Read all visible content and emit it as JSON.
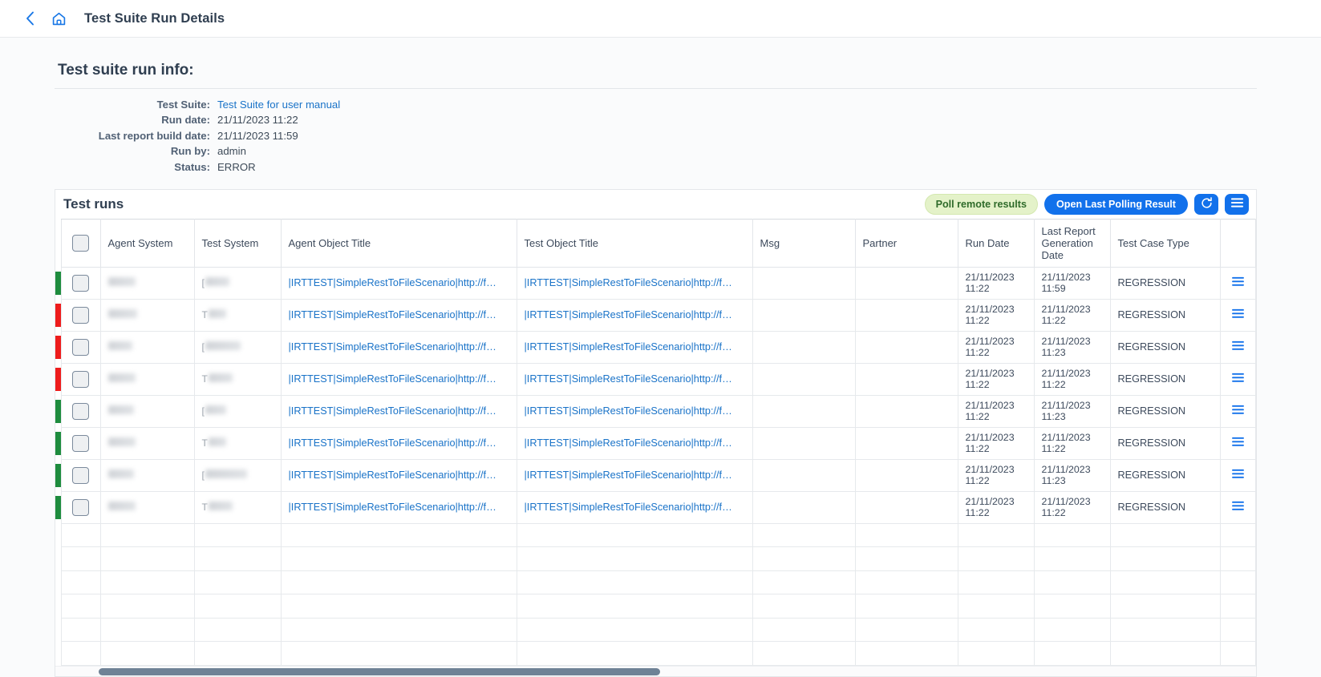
{
  "header": {
    "back_icon": "chevron-left-icon",
    "home_icon": "home-icon",
    "title": "Test Suite Run Details"
  },
  "info": {
    "section_title": "Test suite run info:",
    "rows": [
      {
        "label": "Test Suite:",
        "value": "Test Suite for user manual",
        "is_link": true
      },
      {
        "label": "Run date:",
        "value": "21/11/2023 11:22",
        "is_link": false
      },
      {
        "label": "Last report build date:",
        "value": "21/11/2023 11:59",
        "is_link": false
      },
      {
        "label": "Run by:",
        "value": "admin",
        "is_link": false
      },
      {
        "label": "Status:",
        "value": "ERROR",
        "is_link": false
      }
    ]
  },
  "test_runs": {
    "title": "Test runs",
    "toolbar": {
      "poll_label": "Poll remote results",
      "open_label": "Open Last Polling Result",
      "refresh_icon": "refresh-icon",
      "menu_icon": "hamburger-menu-icon"
    },
    "columns": [
      "",
      "",
      "Agent System",
      "Test System",
      "Agent Object Title",
      "Test Object Title",
      "Msg",
      "Partner",
      "Run Date",
      "Last Report Generation Date",
      "Test Case Type",
      ""
    ],
    "column_headers": {
      "agent_system": "Agent System",
      "test_system": "Test System",
      "agent_object_title": "Agent Object Title",
      "test_object_title": "Test Object Title",
      "msg": "Msg",
      "partner": "Partner",
      "run_date": "Run Date",
      "last_report_generation_date": "Last Report Generation Date",
      "test_case_type": "Test Case Type"
    },
    "object_title_text": "|IRTTEST|SimpleRestToFileScenario|http://f…",
    "rows": [
      {
        "status_color": "#1e8c3e",
        "agent_object_title": "|IRTTEST|SimpleRestToFileScenario|http://f…",
        "test_object_title": "|IRTTEST|SimpleRestToFileScenario|http://f…",
        "msg": "",
        "partner": "",
        "run_date": "21/11/2023 11:22",
        "gen_date": "21/11/2023 11:59",
        "test_case_type": "REGRESSION"
      },
      {
        "status_color": "#ee1c1c",
        "agent_object_title": "|IRTTEST|SimpleRestToFileScenario|http://f…",
        "test_object_title": "|IRTTEST|SimpleRestToFileScenario|http://f…",
        "msg": "",
        "partner": "",
        "run_date": "21/11/2023 11:22",
        "gen_date": "21/11/2023 11:22",
        "test_case_type": "REGRESSION"
      },
      {
        "status_color": "#ee1c1c",
        "agent_object_title": "|IRTTEST|SimpleRestToFileScenario|http://f…",
        "test_object_title": "|IRTTEST|SimpleRestToFileScenario|http://f…",
        "msg": "",
        "partner": "",
        "run_date": "21/11/2023 11:22",
        "gen_date": "21/11/2023 11:23",
        "test_case_type": "REGRESSION"
      },
      {
        "status_color": "#ee1c1c",
        "agent_object_title": "|IRTTEST|SimpleRestToFileScenario|http://f…",
        "test_object_title": "|IRTTEST|SimpleRestToFileScenario|http://f…",
        "msg": "",
        "partner": "",
        "run_date": "21/11/2023 11:22",
        "gen_date": "21/11/2023 11:22",
        "test_case_type": "REGRESSION"
      },
      {
        "status_color": "#1e8c3e",
        "agent_object_title": "|IRTTEST|SimpleRestToFileScenario|http://f…",
        "test_object_title": "|IRTTEST|SimpleRestToFileScenario|http://f…",
        "msg": "",
        "partner": "",
        "run_date": "21/11/2023 11:22",
        "gen_date": "21/11/2023 11:23",
        "test_case_type": "REGRESSION"
      },
      {
        "status_color": "#1e8c3e",
        "agent_object_title": "|IRTTEST|SimpleRestToFileScenario|http://f…",
        "test_object_title": "|IRTTEST|SimpleRestToFileScenario|http://f…",
        "msg": "",
        "partner": "",
        "run_date": "21/11/2023 11:22",
        "gen_date": "21/11/2023 11:22",
        "test_case_type": "REGRESSION"
      },
      {
        "status_color": "#1e8c3e",
        "agent_object_title": "|IRTTEST|SimpleRestToFileScenario|http://f…",
        "test_object_title": "|IRTTEST|SimpleRestToFileScenario|http://f…",
        "msg": "",
        "partner": "",
        "run_date": "21/11/2023 11:22",
        "gen_date": "21/11/2023 11:23",
        "test_case_type": "REGRESSION"
      },
      {
        "status_color": "#1e8c3e",
        "agent_object_title": "|IRTTEST|SimpleRestToFileScenario|http://f…",
        "test_object_title": "|IRTTEST|SimpleRestToFileScenario|http://f…",
        "msg": "",
        "partner": "",
        "run_date": "21/11/2023 11:22",
        "gen_date": "21/11/2023 11:22",
        "test_case_type": "REGRESSION"
      }
    ],
    "empty_row_count": 6
  },
  "colors": {
    "accent_blue": "#1271eb",
    "link_blue": "#1a73c8",
    "status_ok": "#1e8c3e",
    "status_error": "#ee1c1c",
    "poll_bg": "#e4f2c9",
    "poll_text": "#2f6b2a"
  },
  "scrollbar": {
    "orientation": "horizontal"
  }
}
